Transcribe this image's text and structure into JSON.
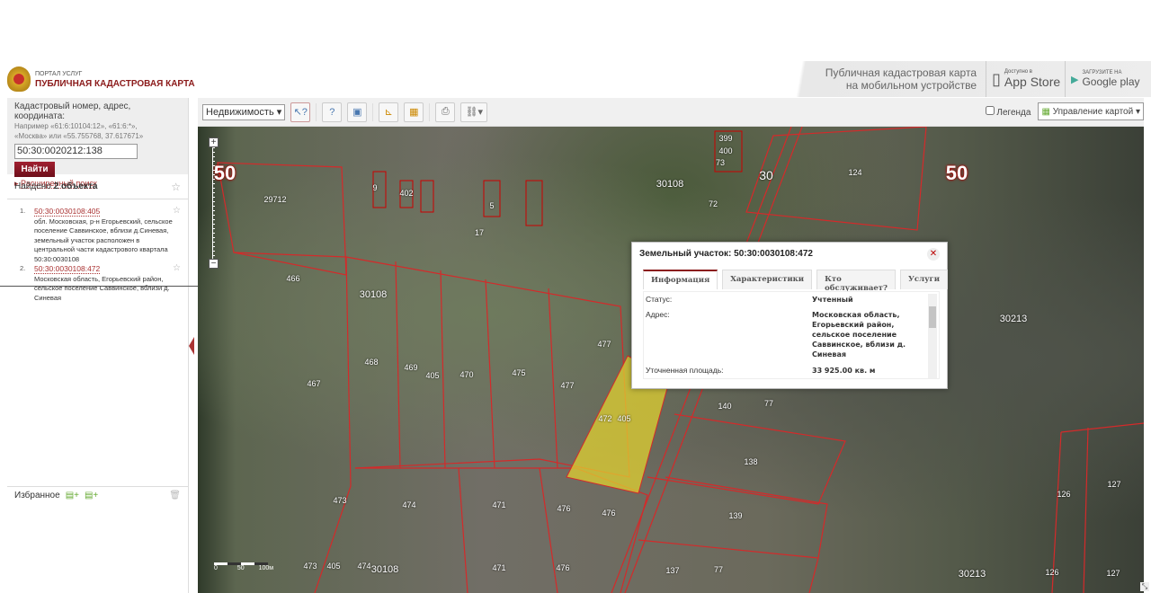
{
  "header": {
    "portal": "ПОРТАЛ УСЛУГ",
    "title": "ПУБЛИЧНАЯ КАДАСТРОВАЯ КАРТА",
    "mobile_line1": "Публичная кадастровая карта",
    "mobile_line2": "на мобильном устройстве",
    "appstore_small": "Доступно в",
    "appstore": "App Store",
    "gplay_small": "ЗАГРУЗИТЕ НА",
    "gplay": "Google play"
  },
  "toolbar": {
    "layer_select": "Недвижимость",
    "legend_label": "Легенда",
    "map_control": "Управление картой"
  },
  "search": {
    "label": "Кадастровый номер, адрес, координата:",
    "hint1": "Например «61:6:10104:12», «61:6:*»,",
    "hint2": "«Москва» или «55.755768, 37.617671»",
    "value": "50:30:0020212:138",
    "button": "Найти",
    "advanced": "Расширенный поиск"
  },
  "results": {
    "found_prefix": "Найдено ",
    "found_count": "2 объекта",
    "items": [
      {
        "n": "1.",
        "id": "50:30:0030108:405",
        "address": "обл. Московская, р-н Егорьевский, сельское поселение Саввинское, вблизи д.Синевая, земельный участок расположен в центральной части кадастрового квартала 50:30:0030108"
      },
      {
        "n": "2.",
        "id": "50:30:0030108:472",
        "address": "Московская область, Егорьевский район, сельское поселение Саввинское, вблизи д. Синевая"
      }
    ]
  },
  "favorites": {
    "label": "Избранное"
  },
  "popup": {
    "title": "Земельный участок: 50:30:0030108:472",
    "tabs": [
      "Информация",
      "Характеристики",
      "Кто обслуживает?",
      "Услуги"
    ],
    "rows": [
      {
        "label": "Статус:",
        "value": "Учтенный"
      },
      {
        "label": "Адрес:",
        "value": "Московская область, Егорьевский район, сельское поселение Саввинское, вблизи д. Синевая"
      },
      {
        "label": "Уточненная площадь:",
        "value": "33 925.00 кв. м"
      }
    ]
  },
  "scale": {
    "t0": "0",
    "t1": "50",
    "t2": "100м"
  },
  "map_labels": [
    "50",
    "29712",
    "466",
    "30108",
    "467",
    "468",
    "469",
    "405",
    "470",
    "475",
    "477",
    "477",
    "473",
    "474",
    "471",
    "476",
    "476",
    "473",
    "405",
    "474",
    "30108",
    "471",
    "476",
    "137",
    "77",
    "139",
    "138",
    "140",
    "77",
    "124",
    "50",
    "30",
    "30108",
    "30213",
    "126",
    "127",
    "30213",
    "126",
    "127",
    "472",
    "405",
    "399",
    "400",
    "73",
    "72",
    "9",
    "402",
    "5",
    "17"
  ],
  "colors": {
    "accent": "#8b1a1a",
    "parcel_line": "#d42a2a",
    "selected_parcel": "#e0d030"
  }
}
